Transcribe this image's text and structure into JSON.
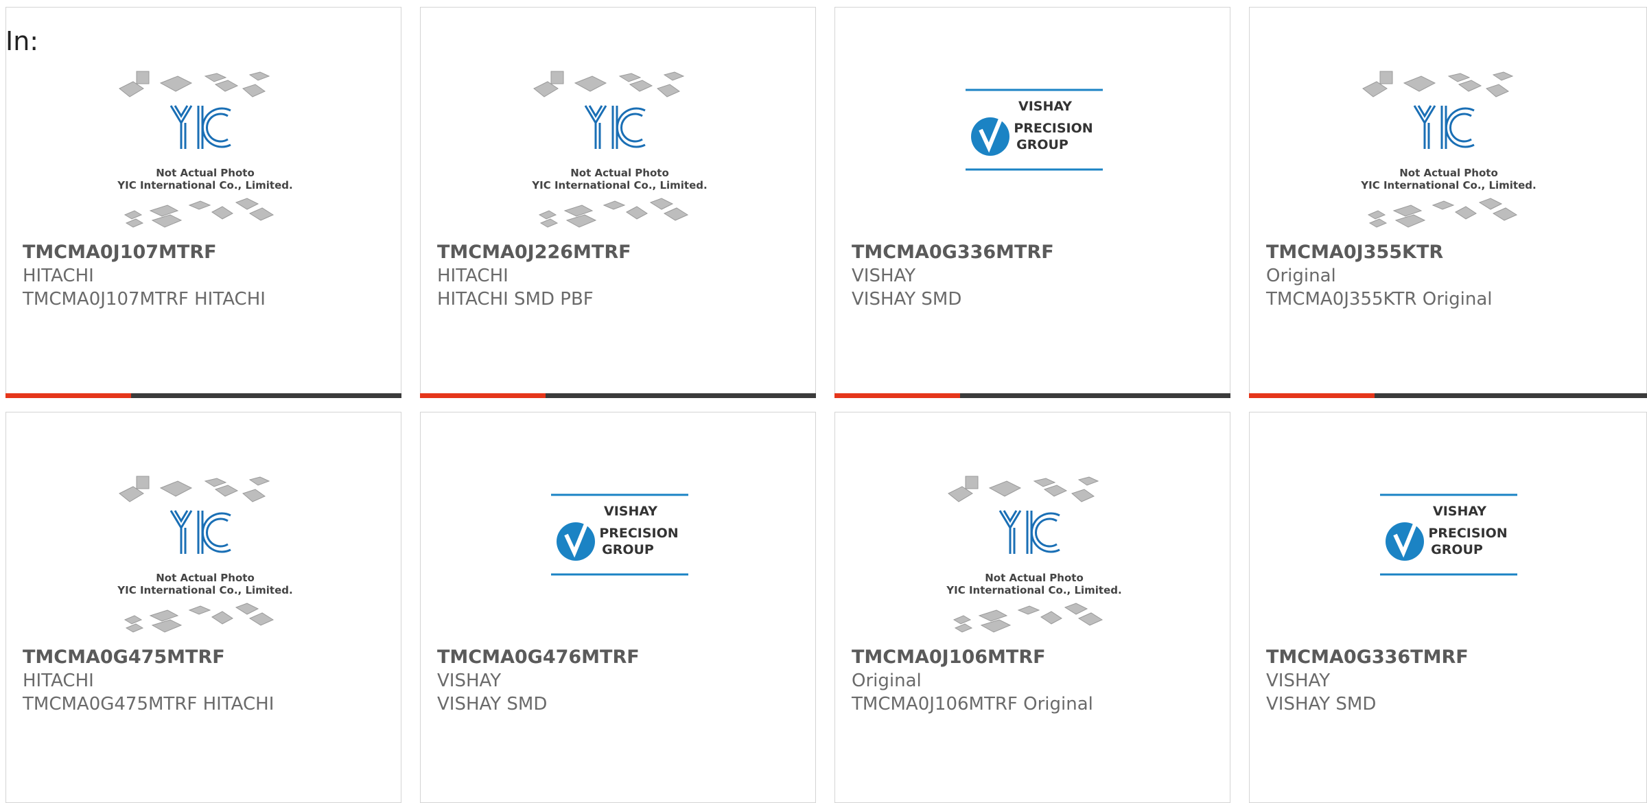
{
  "filter": {
    "label": "In:"
  },
  "placeholder_text": {
    "line1": "Not Actual Photo",
    "line2": "YIC International Co., Limited.",
    "logo": "YIC"
  },
  "vishay_logo": {
    "line1": "VISHAY",
    "line2": "PRECISION",
    "line3": "GROUP"
  },
  "colors": {
    "accent": "#e5361b",
    "bar": "#3b3b3b",
    "yic_blue": "#1a6fb5",
    "vishay_blue": "#1b83c4"
  },
  "products": [
    {
      "part": "TMCMA0J107MTRF",
      "manufacturer": "HITACHI",
      "description": "TMCMA0J107MTRF HITACHI",
      "image": "yic-placeholder"
    },
    {
      "part": "TMCMA0J226MTRF",
      "manufacturer": "HITACHI",
      "description": "HITACHI SMD PBF",
      "image": "yic-placeholder"
    },
    {
      "part": "TMCMA0G336MTRF",
      "manufacturer": "VISHAY",
      "description": "VISHAY SMD",
      "image": "vishay-logo"
    },
    {
      "part": "TMCMA0J355KTR",
      "manufacturer": "Original",
      "description": "TMCMA0J355KTR Original",
      "image": "yic-placeholder"
    },
    {
      "part": "TMCMA0G475MTRF",
      "manufacturer": "HITACHI",
      "description": "TMCMA0G475MTRF HITACHI",
      "image": "yic-placeholder"
    },
    {
      "part": "TMCMA0G476MTRF",
      "manufacturer": "VISHAY",
      "description": "VISHAY SMD",
      "image": "vishay-logo"
    },
    {
      "part": "TMCMA0J106MTRF",
      "manufacturer": "Original",
      "description": "TMCMA0J106MTRF Original",
      "image": "yic-placeholder"
    },
    {
      "part": "TMCMA0G336TMRF",
      "manufacturer": "VISHAY",
      "description": "VISHAY SMD",
      "image": "vishay-logo"
    }
  ]
}
